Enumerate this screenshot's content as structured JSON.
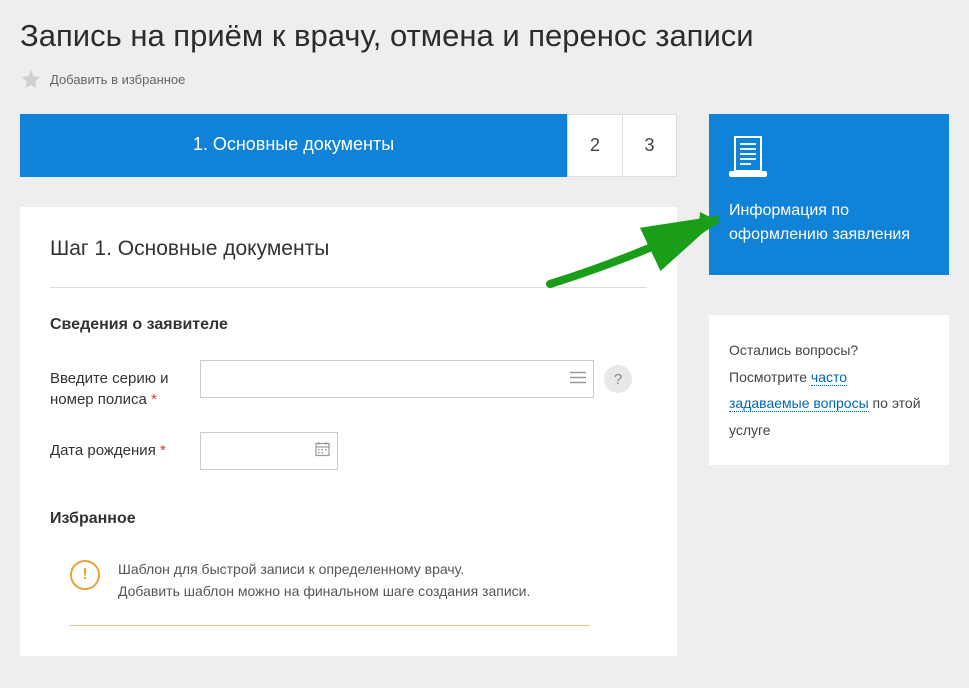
{
  "header": {
    "title": "Запись на приём к врачу, отмена и перенос записи",
    "favLabel": "Добавить в избранное"
  },
  "steps": {
    "activeLabel": "1. Основные документы",
    "step2": "2",
    "step3": "3"
  },
  "form": {
    "stepHeading": "Шаг 1. Основные документы",
    "applicantSection": "Сведения о заявителе",
    "policyLabel": "Введите серию и номер полиса",
    "dobLabel": "Дата рождения",
    "required": "*",
    "helpSymbol": "?"
  },
  "favorites": {
    "title": "Избранное",
    "hintLine1": "Шаблон для быстрой записи к определенному врачу.",
    "hintLine2": "Добавить шаблон можно на финальном шаге создания записи.",
    "hintSymbol": "!"
  },
  "sidebar": {
    "infoTitle": "Информация по оформлению заявления",
    "faqLine1": "Остались вопросы?",
    "faqPrefix": "Посмотрите ",
    "faqLink": "часто задаваемые вопросы",
    "faqSuffix": " по этой услуге"
  }
}
